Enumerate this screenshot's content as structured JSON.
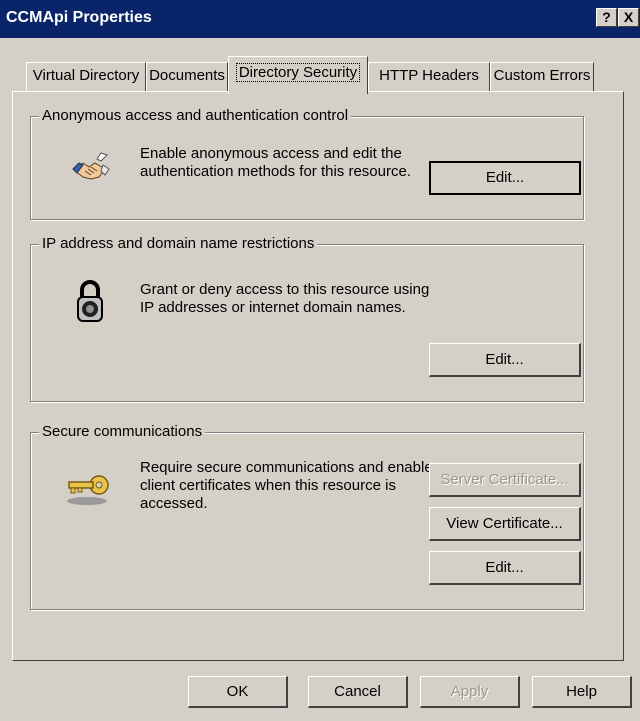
{
  "window": {
    "title": "CCMApi Properties",
    "help_button": "?",
    "close_button": "X"
  },
  "tabs": [
    {
      "label": "Virtual Directory"
    },
    {
      "label": "Documents"
    },
    {
      "label": "Directory Security",
      "active": true
    },
    {
      "label": "HTTP Headers"
    },
    {
      "label": "Custom Errors"
    }
  ],
  "groups": {
    "anonymous": {
      "title": "Anonymous access and authentication control",
      "description": "Enable anonymous access and edit the authentication methods for this resource.",
      "icon": "handshake-icon",
      "edit_label": "Edit..."
    },
    "ip": {
      "title": "IP address and domain name restrictions",
      "description": "Grant or deny access to this resource using IP addresses or internet domain names.",
      "icon": "padlock-icon",
      "edit_label": "Edit..."
    },
    "secure": {
      "title": "Secure communications",
      "description": "Require secure communications and enable client certificates when this resource is accessed.",
      "icon": "key-icon",
      "server_cert_label": "Server Certificate...",
      "view_cert_label": "View Certificate...",
      "edit_label": "Edit..."
    }
  },
  "footer": {
    "ok": "OK",
    "cancel": "Cancel",
    "apply": "Apply",
    "help": "Help"
  },
  "colors": {
    "titlebar": "#0a246a",
    "face": "#d4d0c8",
    "disabled_text": "#9a978f"
  }
}
